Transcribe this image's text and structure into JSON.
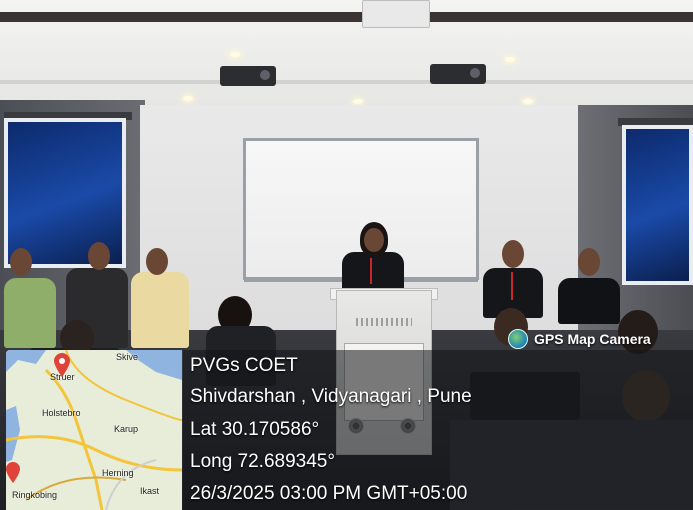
{
  "overlay": {
    "app_badge": "GPS Map Camera",
    "place_title": "PVGs COET",
    "address": "Shivdarshan , Vidyanagari , Pune",
    "latitude": "Lat 30.170586°",
    "longitude": "Long 72.689345°",
    "datetime": "26/3/2025 03:00 PM GMT+05:00"
  },
  "map": {
    "labels": [
      "Skive",
      "Struer",
      "Holstebro",
      "Karup",
      "Herning",
      "Ikast",
      "Ringkobing"
    ]
  },
  "colors": {
    "pin": "#e0433a",
    "water": "#8fb4e0",
    "road": "#f3c43c"
  }
}
